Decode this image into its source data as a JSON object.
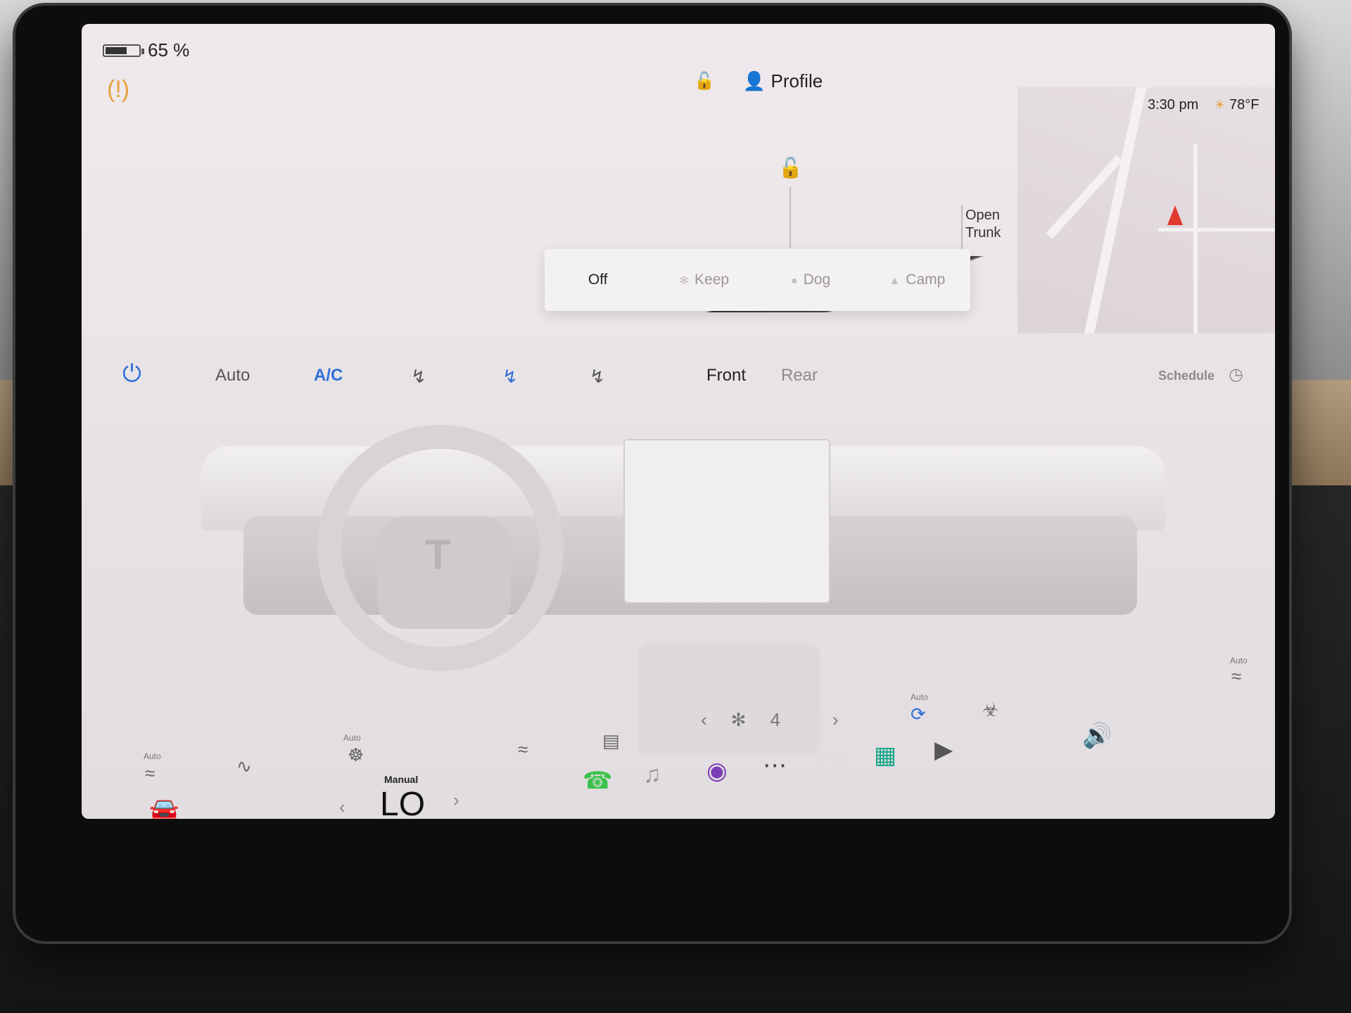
{
  "status": {
    "battery_percent_text": "65 %",
    "battery_level": 0.65
  },
  "header": {
    "profile_label": "Profile",
    "time": "3:30 pm",
    "temperature": "78°F"
  },
  "car": {
    "open_trunk_line1": "Open",
    "open_trunk_line2": "Trunk"
  },
  "climate_modes": {
    "items": [
      {
        "label": "Off"
      },
      {
        "label": "Keep"
      },
      {
        "label": "Dog"
      },
      {
        "label": "Camp"
      }
    ]
  },
  "climate": {
    "auto_label": "Auto",
    "ac_label": "A/C",
    "front_label": "Front",
    "rear_label": "Rear",
    "schedule_label": "Schedule",
    "fan_speed": "4",
    "seat_heat_auto_left": "Auto",
    "steering_heat_auto": "Auto",
    "recirc_auto": "Auto",
    "seat_heat_auto_right": "Auto"
  },
  "dock": {
    "temp_mode": "Manual",
    "temp_value": "LO"
  },
  "colors": {
    "accent_blue": "#2f6fd8",
    "warning_amber": "#e7a23b",
    "nav_red": "#e23a2f",
    "phone_green": "#3cc24c"
  }
}
